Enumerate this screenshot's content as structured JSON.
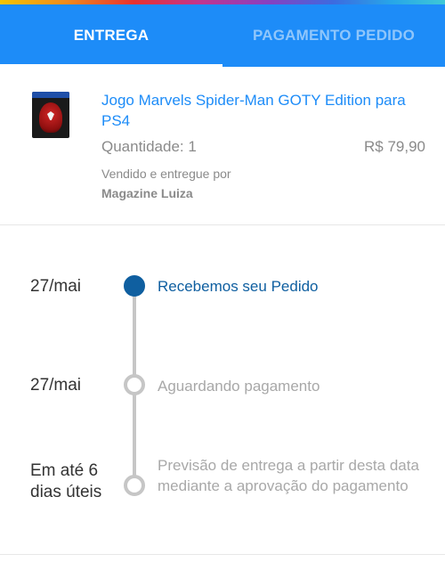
{
  "tabs": [
    {
      "label": "ENTREGA",
      "active": true
    },
    {
      "label": "PAGAMENTO PEDIDO",
      "active": false
    }
  ],
  "colors": {
    "primary": "#1d8cf8",
    "step_done": "#0f5fa0",
    "muted": "#a8a8a8"
  },
  "product": {
    "image_icon": "game-cover-image",
    "title": "Jogo Marvels Spider-Man GOTY Edition para PS4",
    "quantity": "Quantidade: 1",
    "price": "R$ 79,90",
    "seller_label": "Vendido e entregue por",
    "seller_name": "Magazine Luiza"
  },
  "timeline": [
    {
      "date": "27/mai",
      "status": "Recebemos seu Pedido",
      "done": true
    },
    {
      "date": "27/mai",
      "status": "Aguardando pagamento",
      "done": false
    },
    {
      "date": "Em até 6 dias úteis",
      "status": "Previsão de entrega a partir desta data mediante a aprovação do pagamento",
      "done": false
    }
  ]
}
